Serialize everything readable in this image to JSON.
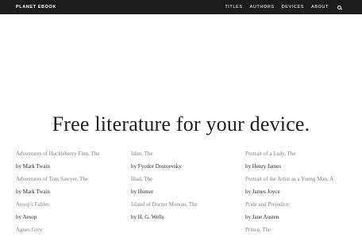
{
  "header": {
    "brand": "PLANET EBOOK",
    "nav": [
      "TITLES",
      "AUTHORS",
      "DEVICES",
      "ABOUT"
    ],
    "search_icon": "search-icon"
  },
  "hero": {
    "title": "Free literature for your device."
  },
  "books": [
    {
      "title": "Adventures of Huckleberry Finn, The",
      "author": "by Mark Twain"
    },
    {
      "title": "Idiot, The",
      "author": "by Fyodor Dostoevsky"
    },
    {
      "title": "Portrait of a Lady, The",
      "author": "by Henry James"
    },
    {
      "title": "Adventures of Tom Sawyer, The",
      "author": "by Mark Twain"
    },
    {
      "title": "Iliad, The",
      "author": "by Homer"
    },
    {
      "title": "Portrait of the Artist as a Young Man, A",
      "author": "by James Joyce"
    },
    {
      "title": "Aesop's Fables",
      "author": "by Aesop"
    },
    {
      "title": "Island of Doctor Moreau, The",
      "author": "by H. G. Wells"
    },
    {
      "title": "Pride and Prejudice",
      "author": "by Jane Austen"
    },
    {
      "title": "Agnes Grey",
      "author": ""
    },
    {
      "title": "",
      "author": ""
    },
    {
      "title": "Prince, The",
      "author": ""
    }
  ]
}
